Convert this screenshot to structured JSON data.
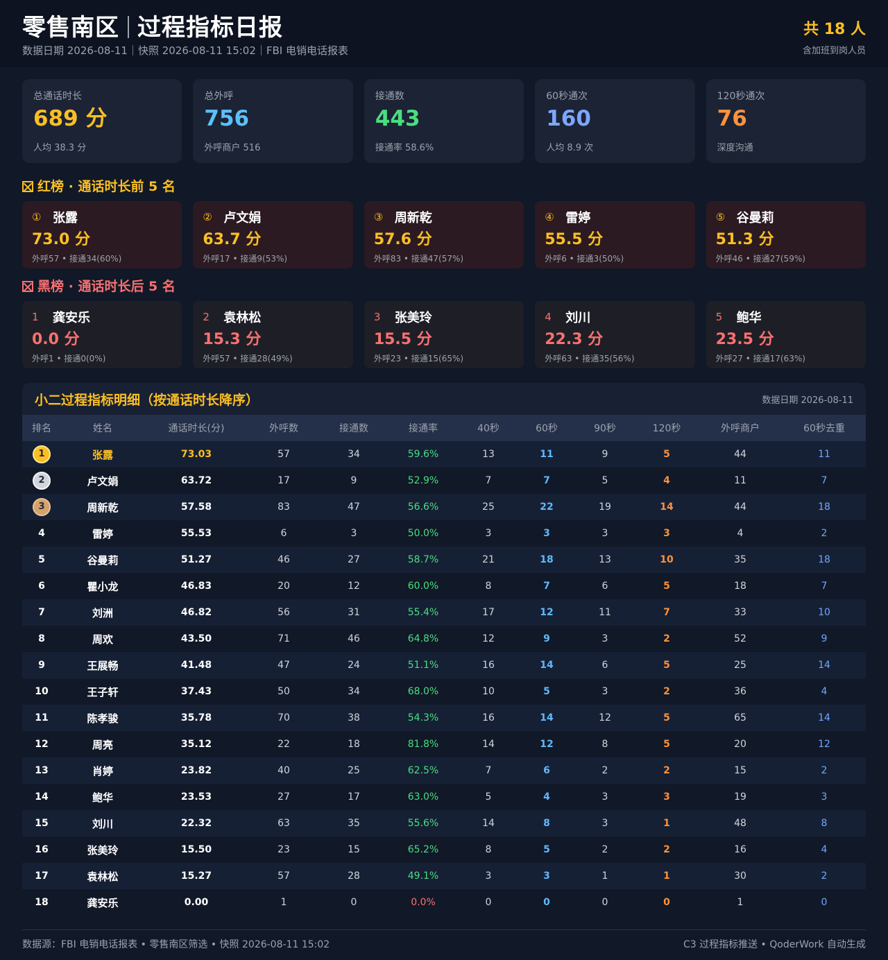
{
  "header": {
    "title_left": "零售南区",
    "title_right": "过程指标日报",
    "subtitle": "数据日期 2026-08-11｜快照 2026-08-11 15:02｜FBI 电销电话报表",
    "count": "共 18 人",
    "count_sub": "含加班到岗人员"
  },
  "kpis": [
    {
      "label": "总通话时长",
      "value": "689 分",
      "sub": "人均 38.3 分",
      "color": "#fbbf24"
    },
    {
      "label": "总外呼",
      "value": "756",
      "sub": "外呼商户 516",
      "color": "#5bc0f8"
    },
    {
      "label": "接通数",
      "value": "443",
      "sub": "接通率 58.6%",
      "color": "#4ade80"
    },
    {
      "label": "60秒通次",
      "value": "160",
      "sub": "人均 8.9 次",
      "color": "#7ea6ff"
    },
    {
      "label": "120秒通次",
      "value": "76",
      "sub": "深度沟通",
      "color": "#fb923c"
    }
  ],
  "red_title": "红榜 · 通话时长前 5 名",
  "black_title": "黑榜 · 通话时长后 5 名",
  "red_cards": [
    {
      "rank": "①",
      "name": "张露",
      "value": "73.0 分",
      "sub": "外呼57 • 接通34(60%)"
    },
    {
      "rank": "②",
      "name": "卢文娟",
      "value": "63.7 分",
      "sub": "外呼17 • 接通9(53%)"
    },
    {
      "rank": "③",
      "name": "周新乾",
      "value": "57.6 分",
      "sub": "外呼83 • 接通47(57%)"
    },
    {
      "rank": "④",
      "name": "雷婷",
      "value": "55.5 分",
      "sub": "外呼6 • 接通3(50%)"
    },
    {
      "rank": "⑤",
      "name": "谷曼莉",
      "value": "51.3 分",
      "sub": "外呼46 • 接通27(59%)"
    }
  ],
  "black_cards": [
    {
      "rank": "1",
      "name": "龚安乐",
      "value": "0.0 分",
      "sub": "外呼1 • 接通0(0%)"
    },
    {
      "rank": "2",
      "name": "袁林松",
      "value": "15.3 分",
      "sub": "外呼57 • 接通28(49%)"
    },
    {
      "rank": "3",
      "name": "张美玲",
      "value": "15.5 分",
      "sub": "外呼23 • 接通15(65%)"
    },
    {
      "rank": "4",
      "name": "刘川",
      "value": "22.3 分",
      "sub": "外呼63 • 接通35(56%)"
    },
    {
      "rank": "5",
      "name": "鲍华",
      "value": "23.5 分",
      "sub": "外呼27 • 接通17(63%)"
    }
  ],
  "table": {
    "title": "小二过程指标明细（按通话时长降序）",
    "date": "数据日期 2026-08-11",
    "columns": [
      "排名",
      "姓名",
      "通话时长(分)",
      "外呼数",
      "接通数",
      "接通率",
      "40秒",
      "60秒",
      "90秒",
      "120秒",
      "外呼商户",
      "60秒去重"
    ],
    "rows": [
      [
        "1",
        "张露",
        "73.03",
        "57",
        "34",
        "59.6%",
        "13",
        "11",
        "9",
        "5",
        "44",
        "11"
      ],
      [
        "2",
        "卢文娟",
        "63.72",
        "17",
        "9",
        "52.9%",
        "7",
        "7",
        "5",
        "4",
        "11",
        "7"
      ],
      [
        "3",
        "周新乾",
        "57.58",
        "83",
        "47",
        "56.6%",
        "25",
        "22",
        "19",
        "14",
        "44",
        "18"
      ],
      [
        "4",
        "雷婷",
        "55.53",
        "6",
        "3",
        "50.0%",
        "3",
        "3",
        "3",
        "3",
        "4",
        "2"
      ],
      [
        "5",
        "谷曼莉",
        "51.27",
        "46",
        "27",
        "58.7%",
        "21",
        "18",
        "13",
        "10",
        "35",
        "18"
      ],
      [
        "6",
        "瞿小龙",
        "46.83",
        "20",
        "12",
        "60.0%",
        "8",
        "7",
        "6",
        "5",
        "18",
        "7"
      ],
      [
        "7",
        "刘洲",
        "46.82",
        "56",
        "31",
        "55.4%",
        "17",
        "12",
        "11",
        "7",
        "33",
        "10"
      ],
      [
        "8",
        "周欢",
        "43.50",
        "71",
        "46",
        "64.8%",
        "12",
        "9",
        "3",
        "2",
        "52",
        "9"
      ],
      [
        "9",
        "王展畅",
        "41.48",
        "47",
        "24",
        "51.1%",
        "16",
        "14",
        "6",
        "5",
        "25",
        "14"
      ],
      [
        "10",
        "王子轩",
        "37.43",
        "50",
        "34",
        "68.0%",
        "10",
        "5",
        "3",
        "2",
        "36",
        "4"
      ],
      [
        "11",
        "陈孝骏",
        "35.78",
        "70",
        "38",
        "54.3%",
        "16",
        "14",
        "12",
        "5",
        "65",
        "14"
      ],
      [
        "12",
        "周亮",
        "35.12",
        "22",
        "18",
        "81.8%",
        "14",
        "12",
        "8",
        "5",
        "20",
        "12"
      ],
      [
        "13",
        "肖婷",
        "23.82",
        "40",
        "25",
        "62.5%",
        "7",
        "6",
        "2",
        "2",
        "15",
        "2"
      ],
      [
        "14",
        "鲍华",
        "23.53",
        "27",
        "17",
        "63.0%",
        "5",
        "4",
        "3",
        "3",
        "19",
        "3"
      ],
      [
        "15",
        "刘川",
        "22.32",
        "63",
        "35",
        "55.6%",
        "14",
        "8",
        "3",
        "1",
        "48",
        "8"
      ],
      [
        "16",
        "张美玲",
        "15.50",
        "23",
        "15",
        "65.2%",
        "8",
        "5",
        "2",
        "2",
        "16",
        "4"
      ],
      [
        "17",
        "袁林松",
        "15.27",
        "57",
        "28",
        "49.1%",
        "3",
        "3",
        "1",
        "1",
        "30",
        "2"
      ],
      [
        "18",
        "龚安乐",
        "0.00",
        "1",
        "0",
        "0.0%",
        "0",
        "0",
        "0",
        "0",
        "1",
        "0"
      ]
    ]
  },
  "footer": {
    "left": "数据源：FBI 电销电话报表 • 零售南区筛选 • 快照 2026-08-11 15:02",
    "right": "C3 过程指标推送 • QoderWork 自动生成"
  },
  "colors": {
    "accent_gold": "#fbbf24",
    "accent_red": "#f87171",
    "accent_green": "#4ade80",
    "accent_blue": "#60b8ff",
    "accent_orange": "#fb923c"
  }
}
